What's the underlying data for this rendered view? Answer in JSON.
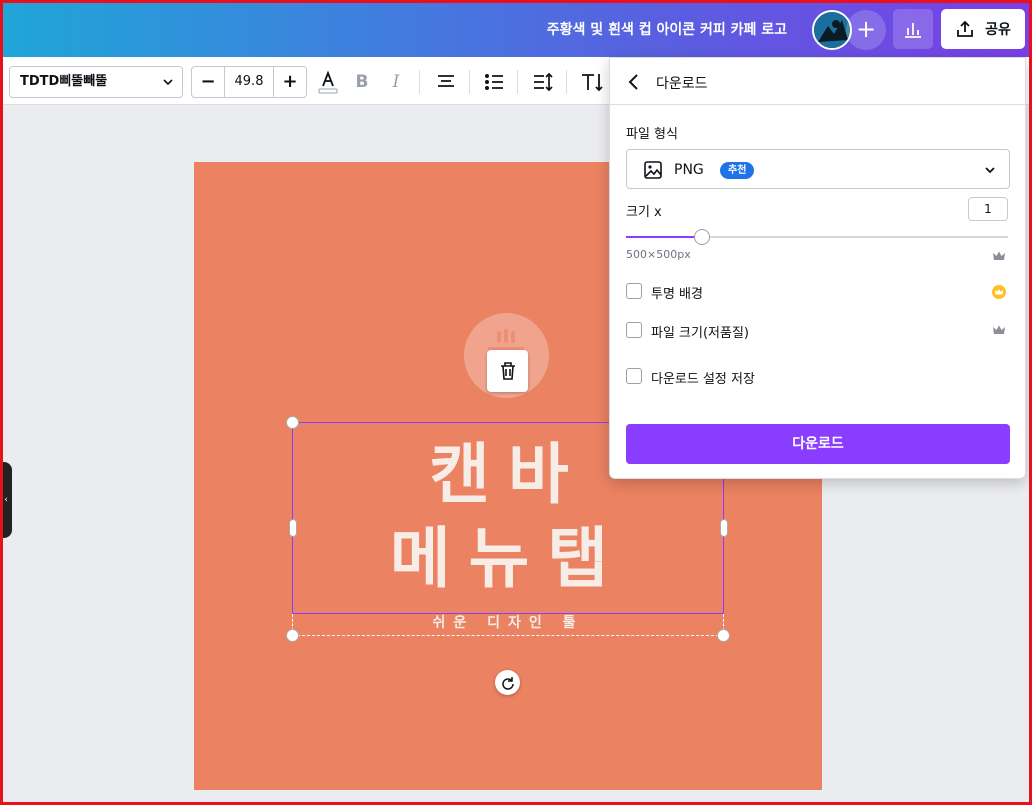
{
  "header": {
    "doc_title": "주황색 및 흰색 컵 아이콘 커피 카페 로고",
    "add_label": "+",
    "share_label": "공유"
  },
  "toolbar": {
    "font_name": "TDTD삐뚤빼뚤",
    "font_size": "49.8",
    "minus_label": "−",
    "plus_label": "+"
  },
  "canvas": {
    "background": "#eb8262",
    "title_line1": "캔바",
    "title_line2": "메뉴탭",
    "subtitle": "쉬운 디자인 툴"
  },
  "download_panel": {
    "title": "다운로드",
    "file_type_label": "파일 형식",
    "file_type_value": "PNG",
    "recommended_badge": "추천",
    "size_label": "크기 x",
    "size_value": "1",
    "slider_level": 0.2,
    "dimensions": "500×500px",
    "options": [
      {
        "label": "투명 배경",
        "checked": false,
        "premium_icon": "crown-gold-icon"
      },
      {
        "label": "파일 크기(저품질)",
        "checked": false,
        "premium_icon": "crown-gray-icon"
      },
      {
        "label": "다운로드 설정 저장",
        "checked": false
      }
    ],
    "download_button": "다운로드"
  },
  "colors": {
    "accent": "#8b3dff",
    "badge": "#1f73e8",
    "frame": "#e8101d"
  }
}
